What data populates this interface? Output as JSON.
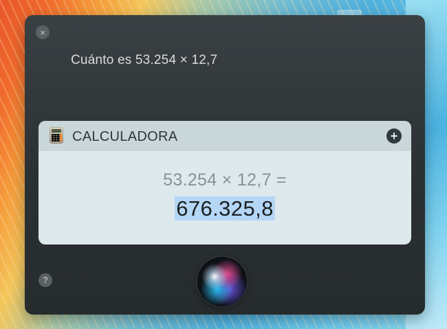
{
  "siri": {
    "close_symbol": "×",
    "query": "Cuánto es 53.254 × 12,7",
    "help_symbol": "?"
  },
  "card": {
    "title": "CALCULADORA",
    "add_symbol": "+",
    "expression": "53.254 × 12,7 =",
    "result": "676.325,8"
  },
  "icons": {
    "close": "close-icon",
    "calculator": "calculator-icon",
    "add": "plus-icon",
    "help": "question-icon",
    "siri": "siri-orb-icon"
  },
  "colors": {
    "panel_bg": "#2b3133",
    "card_header": "#c9d6da",
    "card_body": "#dde9ec",
    "result_highlight": "#b5d6f5"
  }
}
